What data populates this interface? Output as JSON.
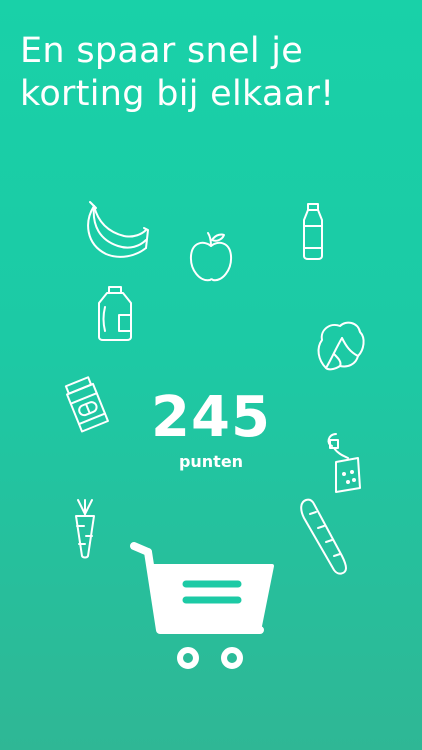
{
  "headline": {
    "line1": "En spaar snel je",
    "line2": "korting bij elkaar!"
  },
  "points": {
    "value": "245",
    "label": "punten"
  },
  "icons": [
    "bananas-icon",
    "apple-icon",
    "milk-bottle-icon",
    "detergent-bottle-icon",
    "lettuce-icon",
    "pill-jar-icon",
    "tea-bag-icon",
    "carrot-icon",
    "baguette-icon",
    "shopping-cart-icon"
  ],
  "colors": {
    "background_top": "#19d1a8",
    "background_bottom": "#2fb795",
    "foreground": "#ffffff"
  }
}
